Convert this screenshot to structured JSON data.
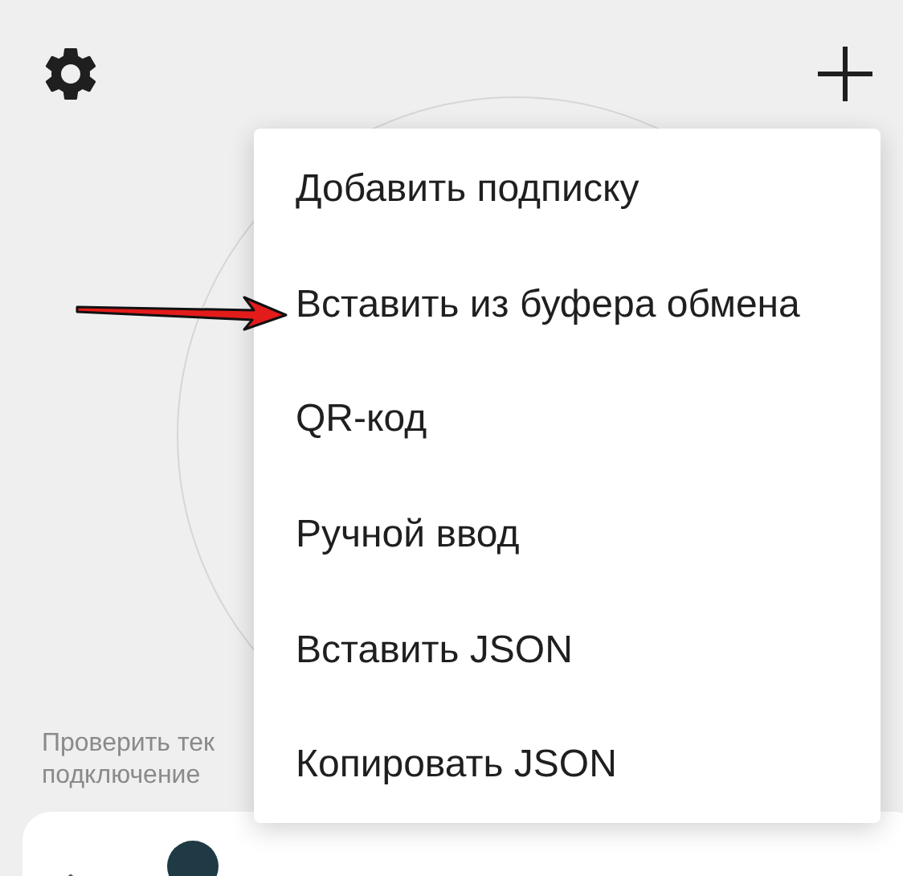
{
  "menu": {
    "items": [
      {
        "label": "Добавить подписку"
      },
      {
        "label": "Вставить из буфера обмена"
      },
      {
        "label": "QR-код"
      },
      {
        "label": "Ручной ввод"
      },
      {
        "label": "Вставить JSON"
      },
      {
        "label": "Копировать JSON"
      }
    ]
  },
  "hint": [
    "Проверить тек",
    "подключение"
  ]
}
